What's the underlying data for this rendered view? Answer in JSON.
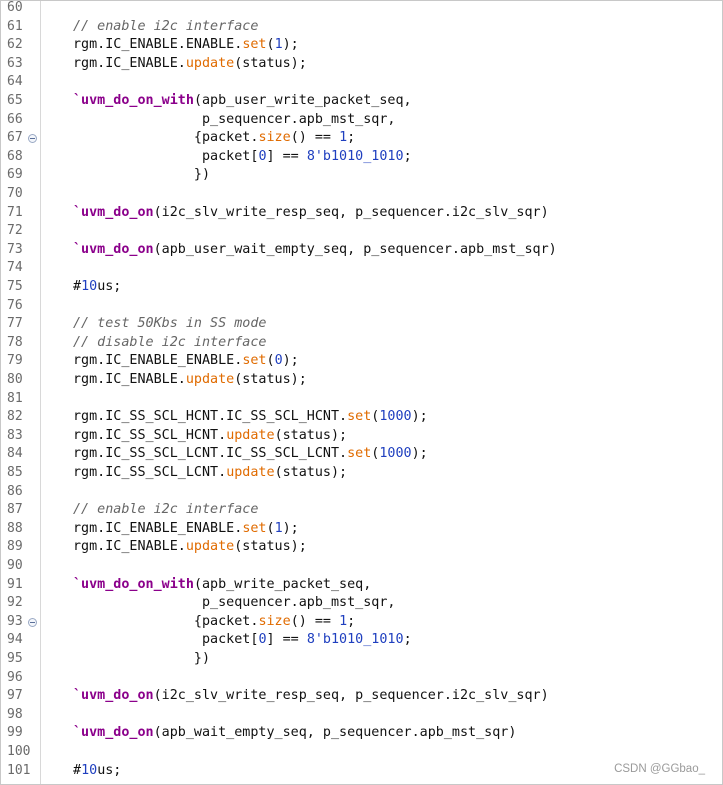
{
  "editor": {
    "lines": [
      {
        "n": "60",
        "code": []
      },
      {
        "n": "61",
        "code": [
          {
            "t": "// enable i2c interface",
            "c": "cmt"
          }
        ]
      },
      {
        "n": "62",
        "code": [
          {
            "t": "rgm.IC_ENABLE.ENABLE."
          },
          {
            "t": "set",
            "c": "fn"
          },
          {
            "t": "("
          },
          {
            "t": "1",
            "c": "num"
          },
          {
            "t": ");"
          }
        ]
      },
      {
        "n": "63",
        "code": [
          {
            "t": "rgm.IC_ENABLE."
          },
          {
            "t": "update",
            "c": "fn"
          },
          {
            "t": "(status);"
          }
        ]
      },
      {
        "n": "64",
        "code": []
      },
      {
        "n": "65",
        "code": [
          {
            "t": "`uvm_do_on_with",
            "c": "mac"
          },
          {
            "t": "(apb_user_write_packet_seq,"
          }
        ]
      },
      {
        "n": "66",
        "code": [
          {
            "t": "                p_sequencer.apb_mst_sqr,"
          }
        ]
      },
      {
        "n": "67",
        "fold": true,
        "code": [
          {
            "t": "               {packet."
          },
          {
            "t": "size",
            "c": "fn"
          },
          {
            "t": "() == "
          },
          {
            "t": "1",
            "c": "num"
          },
          {
            "t": ";"
          }
        ]
      },
      {
        "n": "68",
        "code": [
          {
            "t": "                packet["
          },
          {
            "t": "0",
            "c": "num"
          },
          {
            "t": "] == "
          },
          {
            "t": "8'b1010_1010",
            "c": "num"
          },
          {
            "t": ";"
          }
        ]
      },
      {
        "n": "69",
        "code": [
          {
            "t": "               })"
          }
        ]
      },
      {
        "n": "70",
        "code": []
      },
      {
        "n": "71",
        "code": [
          {
            "t": "`uvm_do_on",
            "c": "mac"
          },
          {
            "t": "(i2c_slv_write_resp_seq, p_sequencer.i2c_slv_sqr)"
          }
        ]
      },
      {
        "n": "72",
        "code": []
      },
      {
        "n": "73",
        "code": [
          {
            "t": "`uvm_do_on",
            "c": "mac"
          },
          {
            "t": "(apb_user_wait_empty_seq, p_sequencer.apb_mst_sqr)"
          }
        ]
      },
      {
        "n": "74",
        "code": []
      },
      {
        "n": "75",
        "code": [
          {
            "t": "#"
          },
          {
            "t": "10",
            "c": "num"
          },
          {
            "t": "us;"
          }
        ]
      },
      {
        "n": "76",
        "code": []
      },
      {
        "n": "77",
        "code": [
          {
            "t": "// test 50Kbs in SS mode",
            "c": "cmt"
          }
        ]
      },
      {
        "n": "78",
        "code": [
          {
            "t": "// disable i2c interface",
            "c": "cmt"
          }
        ]
      },
      {
        "n": "79",
        "code": [
          {
            "t": "rgm.IC_ENABLE_ENABLE."
          },
          {
            "t": "set",
            "c": "fn"
          },
          {
            "t": "("
          },
          {
            "t": "0",
            "c": "num"
          },
          {
            "t": ");"
          }
        ]
      },
      {
        "n": "80",
        "code": [
          {
            "t": "rgm.IC_ENABLE."
          },
          {
            "t": "update",
            "c": "fn"
          },
          {
            "t": "(status);"
          }
        ]
      },
      {
        "n": "81",
        "code": []
      },
      {
        "n": "82",
        "code": [
          {
            "t": "rgm.IC_SS_SCL_HCNT.IC_SS_SCL_HCNT."
          },
          {
            "t": "set",
            "c": "fn"
          },
          {
            "t": "("
          },
          {
            "t": "1000",
            "c": "num"
          },
          {
            "t": ");"
          }
        ]
      },
      {
        "n": "83",
        "code": [
          {
            "t": "rgm.IC_SS_SCL_HCNT."
          },
          {
            "t": "update",
            "c": "fn"
          },
          {
            "t": "(status);"
          }
        ]
      },
      {
        "n": "84",
        "code": [
          {
            "t": "rgm.IC_SS_SCL_LCNT.IC_SS_SCL_LCNT."
          },
          {
            "t": "set",
            "c": "fn"
          },
          {
            "t": "("
          },
          {
            "t": "1000",
            "c": "num"
          },
          {
            "t": ");"
          }
        ]
      },
      {
        "n": "85",
        "code": [
          {
            "t": "rgm.IC_SS_SCL_LCNT."
          },
          {
            "t": "update",
            "c": "fn"
          },
          {
            "t": "(status);"
          }
        ]
      },
      {
        "n": "86",
        "code": []
      },
      {
        "n": "87",
        "code": [
          {
            "t": "// enable i2c interface",
            "c": "cmt"
          }
        ]
      },
      {
        "n": "88",
        "code": [
          {
            "t": "rgm.IC_ENABLE_ENABLE."
          },
          {
            "t": "set",
            "c": "fn"
          },
          {
            "t": "("
          },
          {
            "t": "1",
            "c": "num"
          },
          {
            "t": ");"
          }
        ]
      },
      {
        "n": "89",
        "code": [
          {
            "t": "rgm.IC_ENABLE."
          },
          {
            "t": "update",
            "c": "fn"
          },
          {
            "t": "(status);"
          }
        ]
      },
      {
        "n": "90",
        "code": []
      },
      {
        "n": "91",
        "code": [
          {
            "t": "`uvm_do_on_with",
            "c": "mac"
          },
          {
            "t": "(apb_write_packet_seq,"
          }
        ]
      },
      {
        "n": "92",
        "code": [
          {
            "t": "                p_sequencer.apb_mst_sqr,"
          }
        ]
      },
      {
        "n": "93",
        "fold": true,
        "code": [
          {
            "t": "               {packet."
          },
          {
            "t": "size",
            "c": "fn"
          },
          {
            "t": "() == "
          },
          {
            "t": "1",
            "c": "num"
          },
          {
            "t": ";"
          }
        ]
      },
      {
        "n": "94",
        "code": [
          {
            "t": "                packet["
          },
          {
            "t": "0",
            "c": "num"
          },
          {
            "t": "] == "
          },
          {
            "t": "8'b1010_1010",
            "c": "num"
          },
          {
            "t": ";"
          }
        ]
      },
      {
        "n": "95",
        "code": [
          {
            "t": "               })"
          }
        ]
      },
      {
        "n": "96",
        "code": []
      },
      {
        "n": "97",
        "code": [
          {
            "t": "`uvm_do_on",
            "c": "mac"
          },
          {
            "t": "(i2c_slv_write_resp_seq, p_sequencer.i2c_slv_sqr)"
          }
        ]
      },
      {
        "n": "98",
        "code": []
      },
      {
        "n": "99",
        "code": [
          {
            "t": "`uvm_do_on",
            "c": "mac"
          },
          {
            "t": "(apb_wait_empty_seq, p_sequencer.apb_mst_sqr)"
          }
        ]
      },
      {
        "n": "100",
        "code": []
      },
      {
        "n": "101",
        "code": [
          {
            "t": "#"
          },
          {
            "t": "10",
            "c": "num"
          },
          {
            "t": "us;"
          }
        ]
      }
    ]
  },
  "watermark": "CSDN @GGbao_"
}
